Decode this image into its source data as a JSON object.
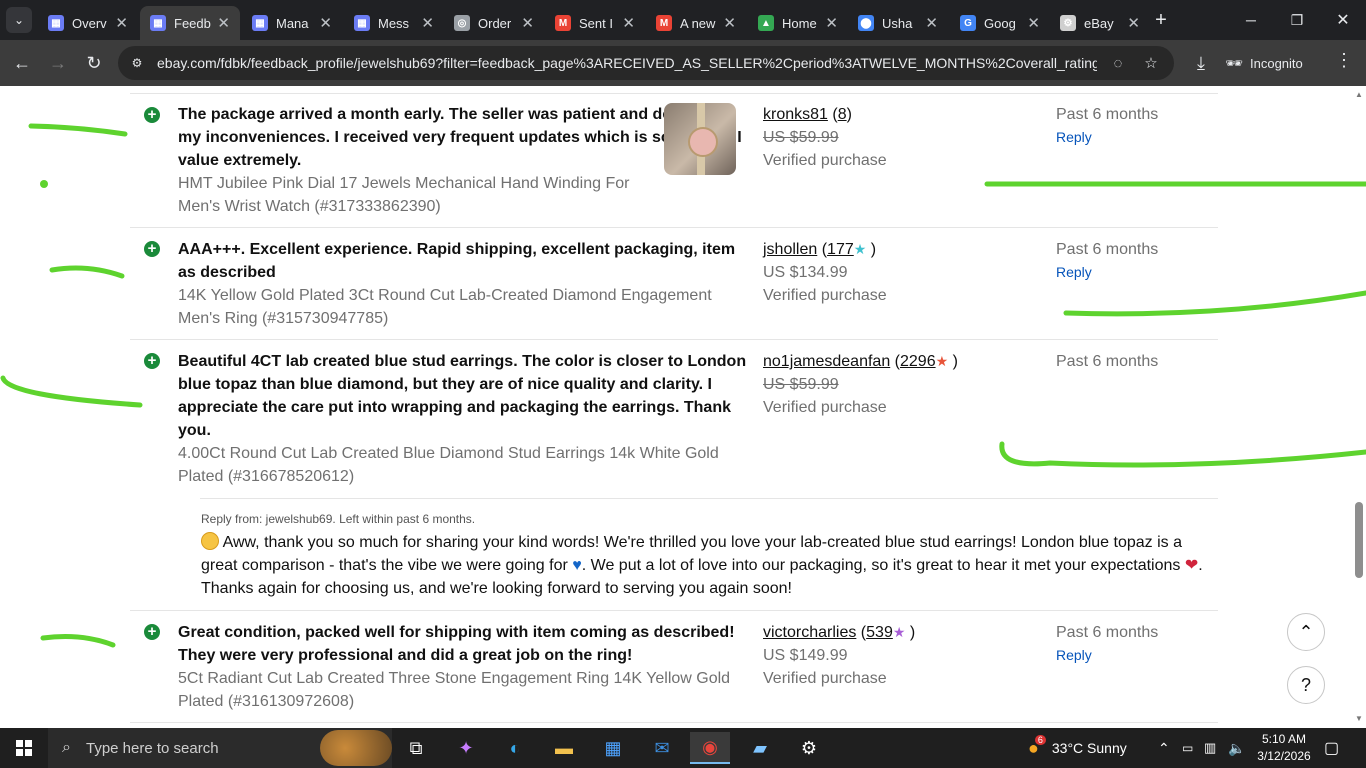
{
  "browser": {
    "tabs": [
      {
        "title": "Overv",
        "color": "#6b7cf4",
        "glyph": "▦"
      },
      {
        "title": "Feedb",
        "color": "#6b7cf4",
        "glyph": "▦",
        "active": true
      },
      {
        "title": "Mana",
        "color": "#6b7cf4",
        "glyph": "▦"
      },
      {
        "title": "Mess",
        "color": "#6b7cf4",
        "glyph": "▦"
      },
      {
        "title": "Order",
        "color": "#9aa0a6",
        "glyph": "◎"
      },
      {
        "title": "Sent I",
        "color": "#ea4335",
        "glyph": "M"
      },
      {
        "title": "A new",
        "color": "#ea4335",
        "glyph": "M"
      },
      {
        "title": "Home",
        "color": "#34a853",
        "glyph": "▲"
      },
      {
        "title": "Usha",
        "color": "#4285f4",
        "glyph": "⬤"
      },
      {
        "title": "Goog",
        "color": "#4285f4",
        "glyph": "G"
      },
      {
        "title": "eBay",
        "color": "#cfcfcf",
        "glyph": "⚙"
      }
    ],
    "url": "ebay.com/fdbk/feedback_profile/jewelshub69?filter=feedback_page%3ARECEIVED_AS_SELLER%2Cperiod%3ATWELVE_MONTHS%2Coverall_rating%3A...",
    "incognito_label": "Incognito"
  },
  "feedback": [
    {
      "comment": "The package arrived a month early. The seller was patient and dealt with my inconveniences. I received very frequent updates which is something I value extremely.",
      "item": "HMT Jubilee Pink Dial 17 Jewels Mechanical Hand Winding For Men's Wrist Watch (#317333862390)",
      "buyer": "kronks81",
      "score": "8",
      "star_color": "",
      "price": "US $59.99",
      "verified": "Verified purchase",
      "period": "Past 6 months",
      "reply": "Reply"
    },
    {
      "comment": "AAA+++. Excellent experience. Rapid shipping, excellent packaging, item as described",
      "item": "14K Yellow Gold Plated 3Ct Round Cut Lab-Created Diamond Engagement Men's Ring (#315730947785)",
      "buyer": "jshollen",
      "score": "177",
      "star_color": "#3fc1cf",
      "price": "US $134.99",
      "verified": "Verified purchase",
      "period": "Past 6 months",
      "reply": "Reply"
    },
    {
      "comment": "Beautiful 4CT lab created blue stud earrings. The color is closer to London blue topaz than blue diamond, but they are of nice quality and clarity. I appreciate the care put into wrapping and packaging the earrings. Thank you.",
      "item": "4.00Ct Round Cut Lab Created Blue Diamond Stud Earrings 14k White Gold Plated (#316678520612)",
      "buyer": "no1jamesdeanfan",
      "score": "2296",
      "star_color": "#e8553a",
      "price": "US $59.99",
      "verified": "Verified purchase",
      "period": "Past 6 months",
      "seller_reply_meta": "Reply from: jewelshub69. Left within past 6 months.",
      "seller_reply": {
        "p1": " Aww, thank you so much for sharing your kind words! We're thrilled you love your lab-created blue stud earrings! London blue topaz is a great comparison - that's the vibe we were going for ",
        "p2": ". We put a lot of love into our packaging, so it's great to hear it met your expectations ",
        "p3": ". Thanks again for choosing us, and we're looking forward to serving you again soon!"
      }
    },
    {
      "comment": "Great condition, packed well for shipping with item coming as described! They were very professional and did a great job on the ring!",
      "item": "5Ct Radiant Cut Lab Created Three Stone Engagement Ring 14K Yellow Gold Plated (#316130972608)",
      "buyer": "victorcharlies",
      "score": "539",
      "star_color": "#a85fd6",
      "price": "US $149.99",
      "verified": "Verified purchase",
      "period": "Past 6 months",
      "reply": "Reply"
    }
  ],
  "taskbar": {
    "search_placeholder": "Type here to search",
    "weather": "33°C  Sunny",
    "weather_badge": "6",
    "time": "5:10 AM",
    "date": "3/12/2026"
  }
}
